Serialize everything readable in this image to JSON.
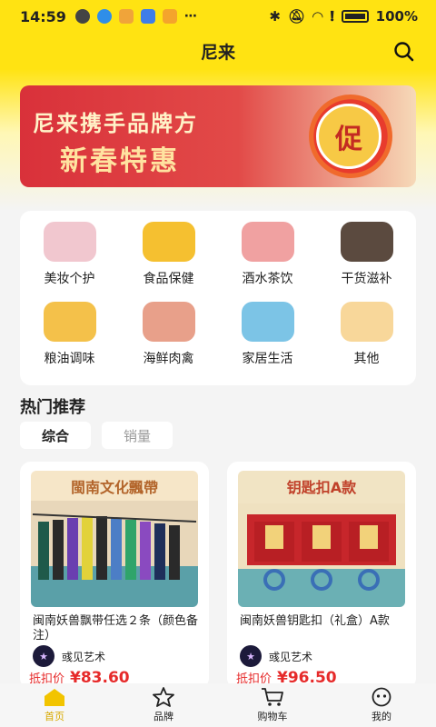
{
  "status_bar": {
    "time": "14:59",
    "battery": "100%"
  },
  "header": {
    "title": "尼来"
  },
  "banner": {
    "line1": "尼来携手品牌方",
    "line2": "新春特惠",
    "badge": "促"
  },
  "categories": [
    {
      "label": "美妆个护",
      "icon": "cosmetics-icon",
      "color": "#f1c7cf"
    },
    {
      "label": "食品保健",
      "icon": "food-health-icon",
      "color": "#f5c030"
    },
    {
      "label": "酒水茶饮",
      "icon": "wine-icon",
      "color": "#f0a1a1"
    },
    {
      "label": "干货滋补",
      "icon": "dried-goods-icon",
      "color": "#5b4a3f"
    },
    {
      "label": "粮油调味",
      "icon": "grain-oil-icon",
      "color": "#f4c14a"
    },
    {
      "label": "海鲜肉禽",
      "icon": "seafood-meat-icon",
      "color": "#e8a08a"
    },
    {
      "label": "家居生活",
      "icon": "home-living-icon",
      "color": "#7cc4e6"
    },
    {
      "label": "其他",
      "icon": "other-icon",
      "color": "#f8d79a"
    }
  ],
  "section": {
    "title": "热门推荐"
  },
  "sort_tabs": [
    {
      "label": "综合",
      "active": true
    },
    {
      "label": "销量",
      "active": false
    }
  ],
  "products": [
    {
      "image_title": "閩南文化飄帶",
      "name": "闽南妖兽飘带任选２条（颜色备注）",
      "shop": "彧见艺术",
      "price_label": "抵扣价",
      "price": "¥83.60"
    },
    {
      "image_title": "钥匙扣A款",
      "name": "闽南妖兽钥匙扣（礼盒）A款",
      "shop": "彧见艺术",
      "price_label": "抵扣价",
      "price": "¥96.50"
    }
  ],
  "tab_bar": [
    {
      "label": "首页",
      "active": true
    },
    {
      "label": "品牌",
      "active": false
    },
    {
      "label": "购物车",
      "active": false
    },
    {
      "label": "我的",
      "active": false
    }
  ],
  "colors": {
    "brand_yellow": "#ffe312",
    "price_red": "#e62a2a",
    "active_tab": "#d8a900"
  }
}
